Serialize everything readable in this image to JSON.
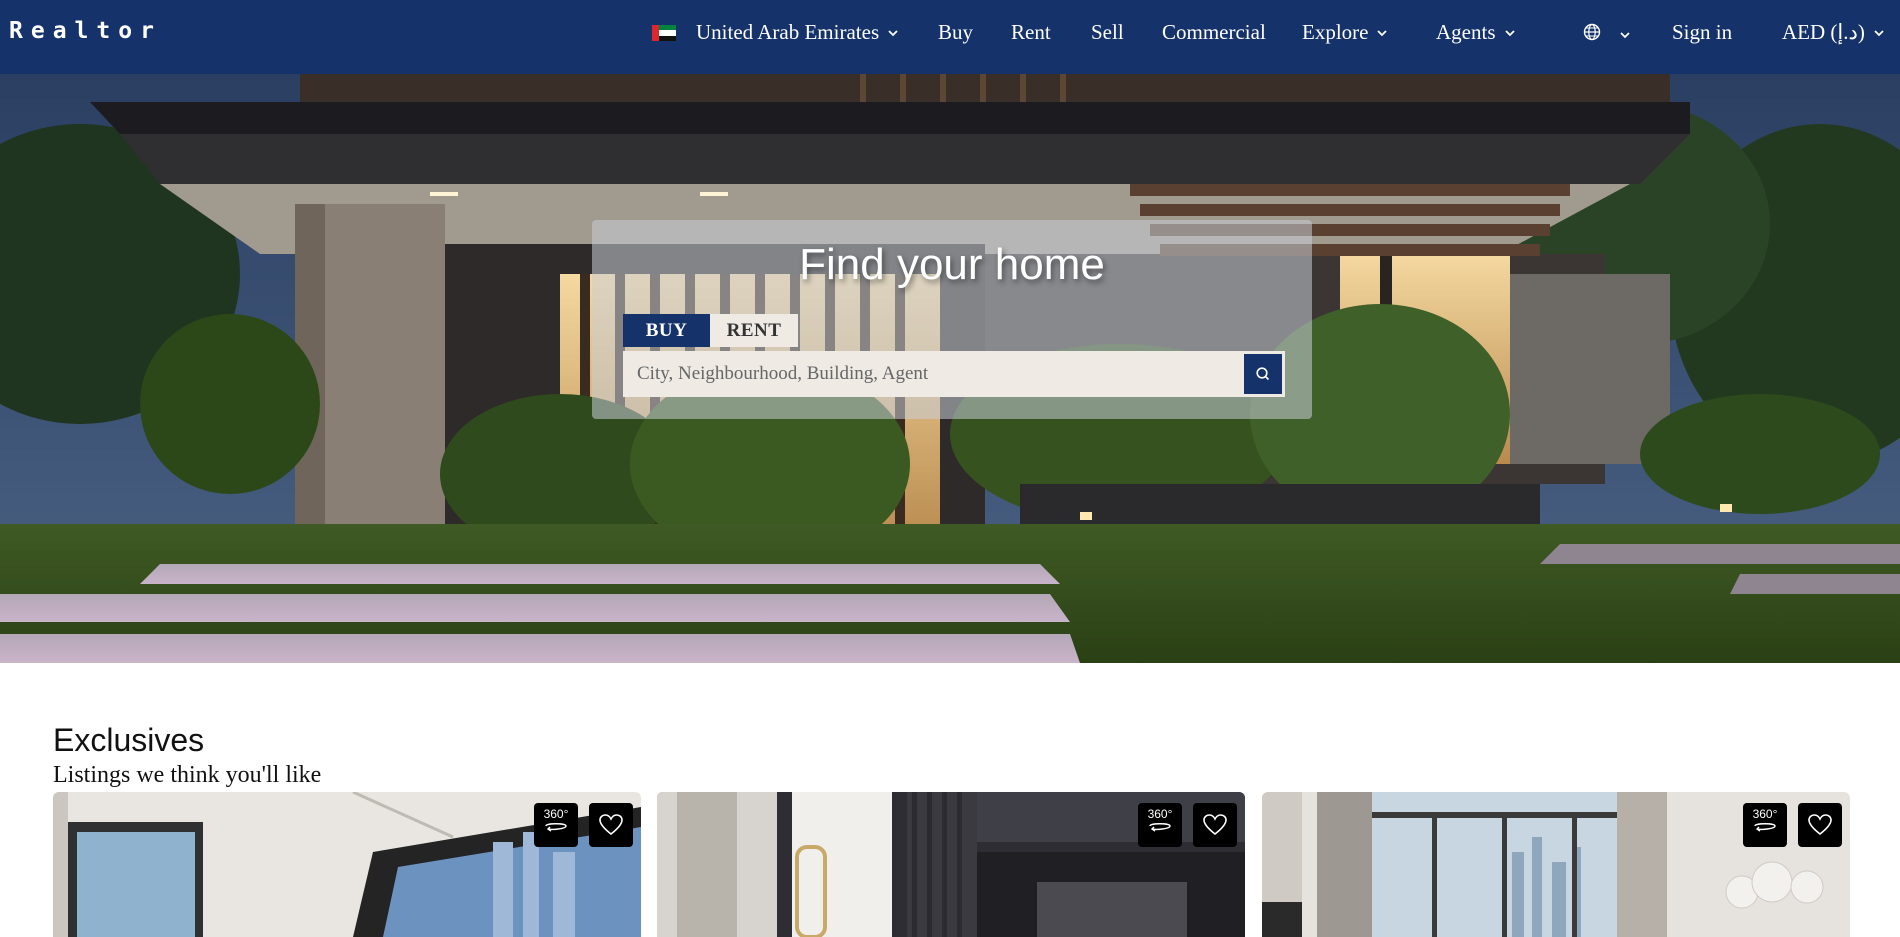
{
  "nav": {
    "logo": "Realtor",
    "country": "United Arab Emirates",
    "items": [
      "Buy",
      "Rent",
      "Sell",
      "Commercial",
      "Explore",
      "Agents"
    ],
    "sign_in": "Sign in",
    "currency": "AED (د.إ)",
    "icons": {
      "language": "globe-icon",
      "dropdown": "chevron-down-icon",
      "flag": "uae-flag-icon"
    }
  },
  "hero": {
    "title": "Find your home",
    "tabs": {
      "buy": "BUY",
      "rent": "RENT"
    },
    "search_placeholder": "City, Neighbourhood, Building, Agent",
    "search_icon": "search-icon"
  },
  "exclusives": {
    "title": "Exclusives",
    "subtitle": "Listings we think you'll like",
    "cards": [
      {
        "badge": "360°"
      },
      {
        "badge": "360°"
      },
      {
        "badge": "360°"
      }
    ]
  },
  "colors": {
    "brand": "#15336a",
    "tab_inactive": "#efeae4"
  }
}
